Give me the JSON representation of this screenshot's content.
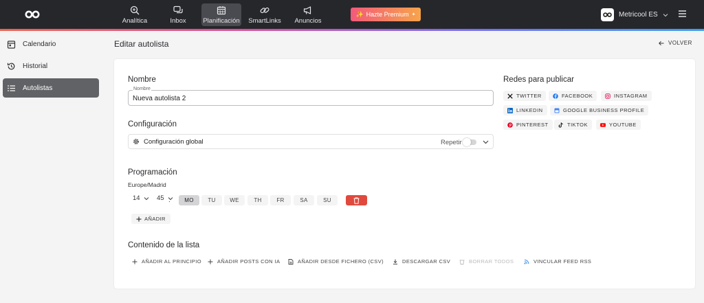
{
  "topbar": {
    "nav": [
      {
        "label": "Analítica",
        "icon": "analytics-icon"
      },
      {
        "label": "Inbox",
        "icon": "inbox-icon"
      },
      {
        "label": "Planificación",
        "icon": "calendar-icon",
        "active": true
      },
      {
        "label": "SmartLinks",
        "icon": "link-icon"
      },
      {
        "label": "Anuncios",
        "icon": "megaphone-icon"
      }
    ],
    "premium_label": "Hazte Premium",
    "account_name": "Metricool ES",
    "accent_colors": [
      "#f0614f",
      "#d94fa0",
      "#7b6cf0",
      "#3aa0f0"
    ]
  },
  "sidebar": {
    "items": [
      {
        "label": "Calendario",
        "icon": "calendar-icon"
      },
      {
        "label": "Historial",
        "icon": "history-icon"
      },
      {
        "label": "Autolistas",
        "icon": "list-icon",
        "active": true
      }
    ]
  },
  "page": {
    "title": "Editar autolista",
    "back_label": "VOLVER"
  },
  "form": {
    "name_section": "Nombre",
    "name_legend": "Nombre",
    "name_value": "Nueva autolista 2",
    "config_section": "Configuración",
    "config_label": "Configuración global",
    "repeat_label": "Repetir",
    "repeat_on": false,
    "schedule_section": "Programación",
    "timezone": "Europe/Madrid",
    "hour": "14",
    "colon": ":",
    "minute": "45",
    "days": [
      {
        "label": "MO",
        "selected": true
      },
      {
        "label": "TU",
        "selected": false
      },
      {
        "label": "WE",
        "selected": false
      },
      {
        "label": "TH",
        "selected": false
      },
      {
        "label": "FR",
        "selected": false
      },
      {
        "label": "SA",
        "selected": false
      },
      {
        "label": "SU",
        "selected": false
      }
    ],
    "add_label": "AÑADIR",
    "content_section": "Contenido de la lista",
    "actions": [
      {
        "label": "AÑADIR AL PRINCIPIO",
        "icon": "plus-icon"
      },
      {
        "label": "AÑADIR POSTS CON IA",
        "icon": "plus-icon"
      },
      {
        "label": "AÑADIR DESDE FICHERO (CSV)",
        "icon": "file-icon"
      },
      {
        "label": "DESCARGAR CSV",
        "icon": "download-icon"
      },
      {
        "label": "BORRAR TODOS",
        "icon": "trash-icon",
        "disabled": true
      },
      {
        "label": "VINCULAR FEED RSS",
        "icon": "rss-icon"
      }
    ]
  },
  "networks": {
    "title": "Redes para publicar",
    "items": [
      {
        "label": "TWITTER",
        "icon": "x-icon",
        "color": "#111111"
      },
      {
        "label": "FACEBOOK",
        "icon": "facebook-icon",
        "color": "#1877f2"
      },
      {
        "label": "INSTAGRAM",
        "icon": "instagram-icon",
        "color": "#e1306c"
      },
      {
        "label": "LINKEDIN",
        "icon": "linkedin-icon",
        "color": "#0a66c2"
      },
      {
        "label": "GOOGLE BUSINESS PROFILE",
        "icon": "google-business-icon",
        "color": "#4285f4"
      },
      {
        "label": "PINTEREST",
        "icon": "pinterest-icon",
        "color": "#e60023"
      },
      {
        "label": "TIKTOK",
        "icon": "tiktok-icon",
        "color": "#111111"
      },
      {
        "label": "YOUTUBE",
        "icon": "youtube-icon",
        "color": "#ff0000"
      }
    ]
  }
}
